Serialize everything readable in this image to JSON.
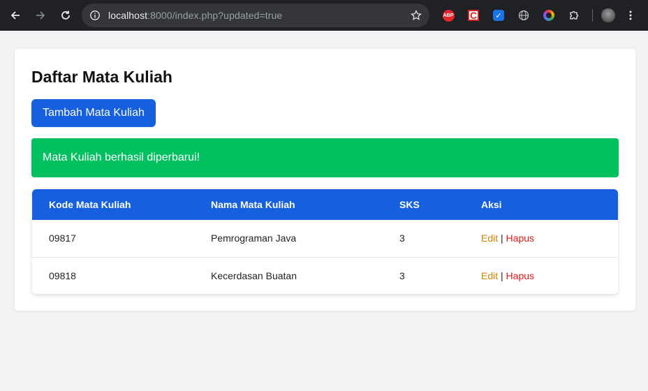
{
  "browser": {
    "url_host": "localhost",
    "url_path": ":8000/index.php?updated=true"
  },
  "page": {
    "title": "Daftar Mata Kuliah",
    "add_button": "Tambah Mata Kuliah",
    "alert": "Mata Kuliah berhasil diperbarui!"
  },
  "table": {
    "headers": [
      "Kode Mata Kuliah",
      "Nama Mata Kuliah",
      "SKS",
      "Aksi"
    ],
    "rows": [
      {
        "kode": "09817",
        "nama": "Pemrograman Java",
        "sks": "3"
      },
      {
        "kode": "09818",
        "nama": "Kecerdasan Buatan",
        "sks": "3"
      }
    ],
    "edit_label": "Edit",
    "separator": "|",
    "delete_label": "Hapus"
  },
  "extensions": [
    "adblock-plus-icon",
    "c-extension-icon",
    "v-extension-icon",
    "globe-icon",
    "color-picker-icon",
    "puzzle-icon"
  ],
  "colors": {
    "primary": "#1660e0",
    "success": "#00c060",
    "edit": "#d08400",
    "delete": "#e01818"
  }
}
